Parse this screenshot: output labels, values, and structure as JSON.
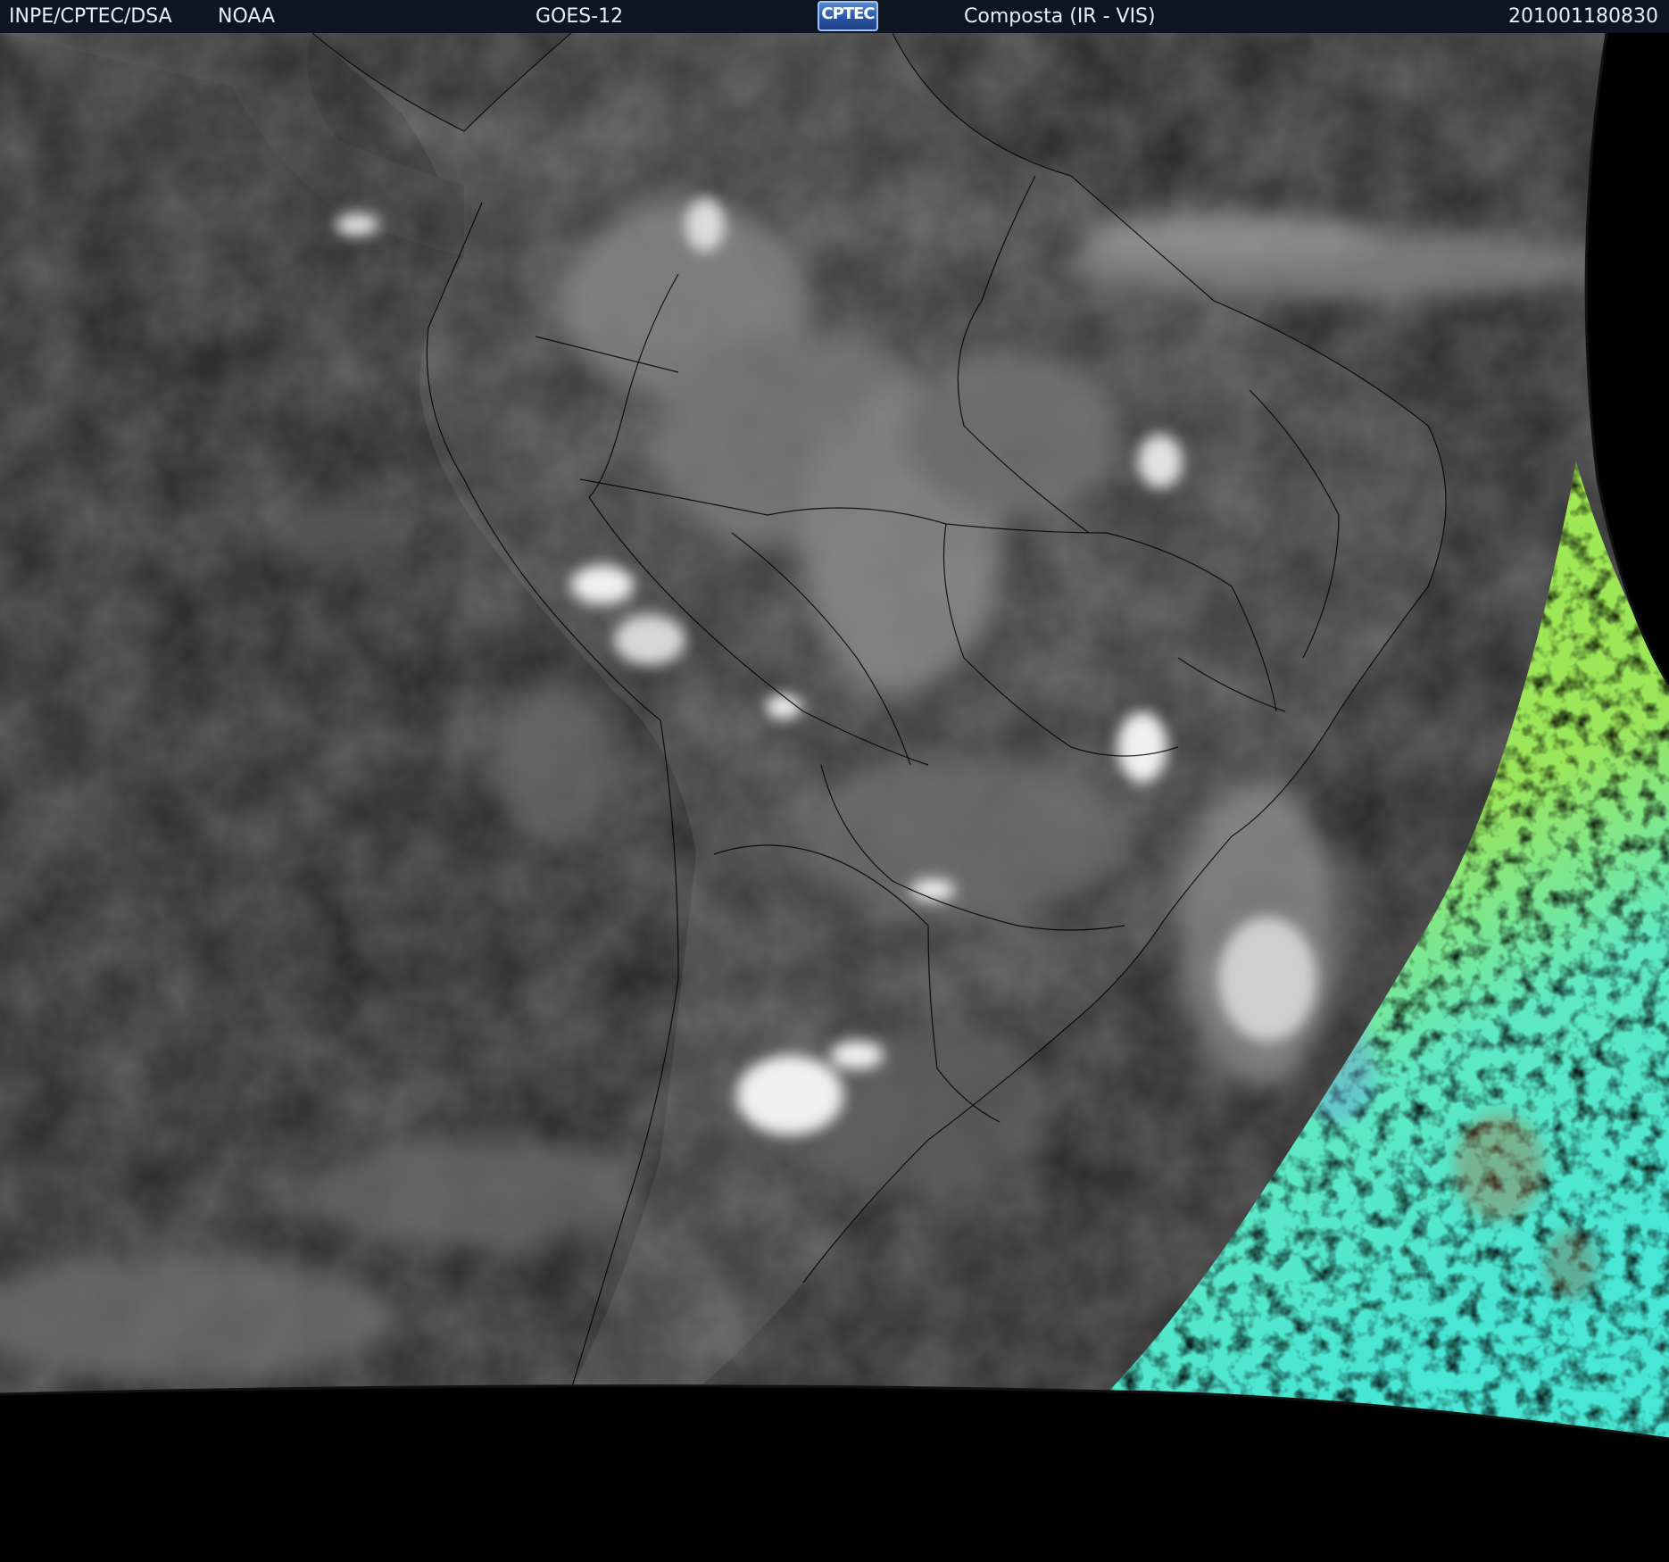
{
  "header": {
    "agency": "INPE/CPTEC/DSA",
    "provider": "NOAA",
    "satellite": "GOES-12",
    "logo_text": "CPTEC",
    "product": "Composta (IR - VIS)",
    "timestamp": "201001180830"
  },
  "colors": {
    "header_bg": "#0c1620",
    "land_cloud_base": "#3c3c3c",
    "ocean_dark": "#262626",
    "vis_green": "#a6e64a",
    "vis_cyan": "#4de8d0",
    "space": "#000000"
  }
}
